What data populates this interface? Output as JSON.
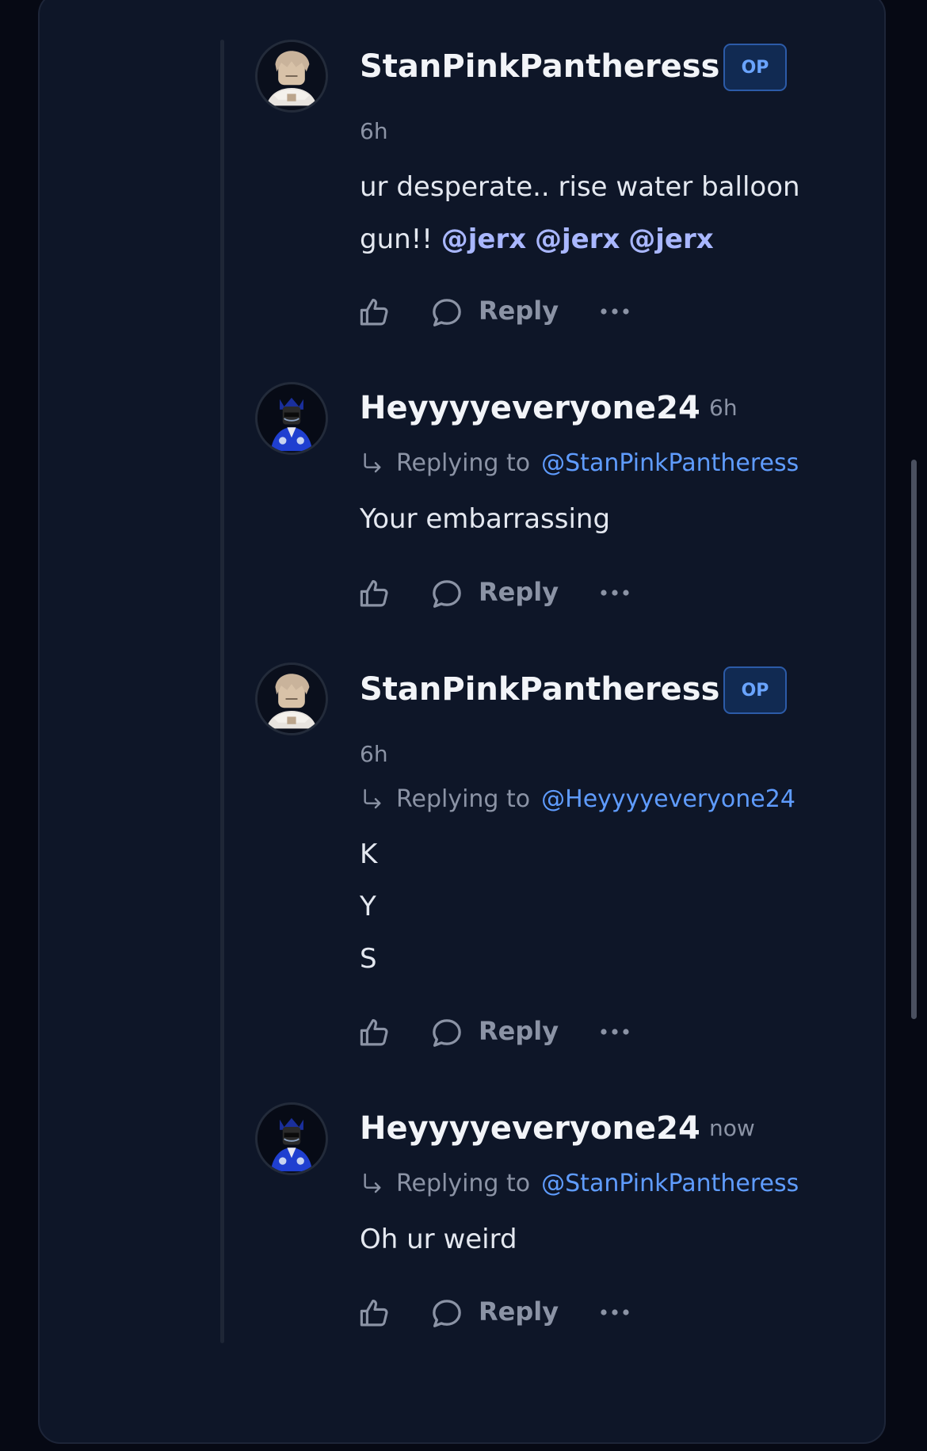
{
  "comments": [
    {
      "username": "StanPinkPantheress",
      "badge": "OP",
      "time": "6h",
      "body_lines": [
        "ur desperate.. rise water balloon",
        "gun!!"
      ],
      "mentions": [
        "@jerx",
        "@jerx",
        "@jerx"
      ],
      "reply_label": "Reply"
    },
    {
      "username": "Heyyyyeveryone24",
      "time": "6h",
      "replying_label": "Replying to",
      "replying_handle": "@StanPinkPantheress",
      "body_lines": [
        "Your embarrassing"
      ],
      "reply_label": "Reply"
    },
    {
      "username": "StanPinkPantheress",
      "badge": "OP",
      "time": "6h",
      "replying_label": "Replying to",
      "replying_handle": "@Heyyyyeveryone24",
      "body_lines": [
        "K",
        "Y",
        "S"
      ],
      "reply_label": "Reply"
    },
    {
      "username": "Heyyyyeveryone24",
      "time": "now",
      "replying_label": "Replying to",
      "replying_handle": "@StanPinkPantheress",
      "body_lines": [
        "Oh ur weird"
      ],
      "reply_label": "Reply"
    }
  ],
  "colors": {
    "background": "#060914",
    "card": "#0e1628",
    "op_badge": "#6aa4ff",
    "mention": "#a9b7ff",
    "handle": "#5f9cff",
    "muted": "#8b93a5"
  },
  "icons": [
    "thumbs-up-icon",
    "comment-bubble-icon",
    "more-dots-icon",
    "reply-arrow-icon"
  ]
}
